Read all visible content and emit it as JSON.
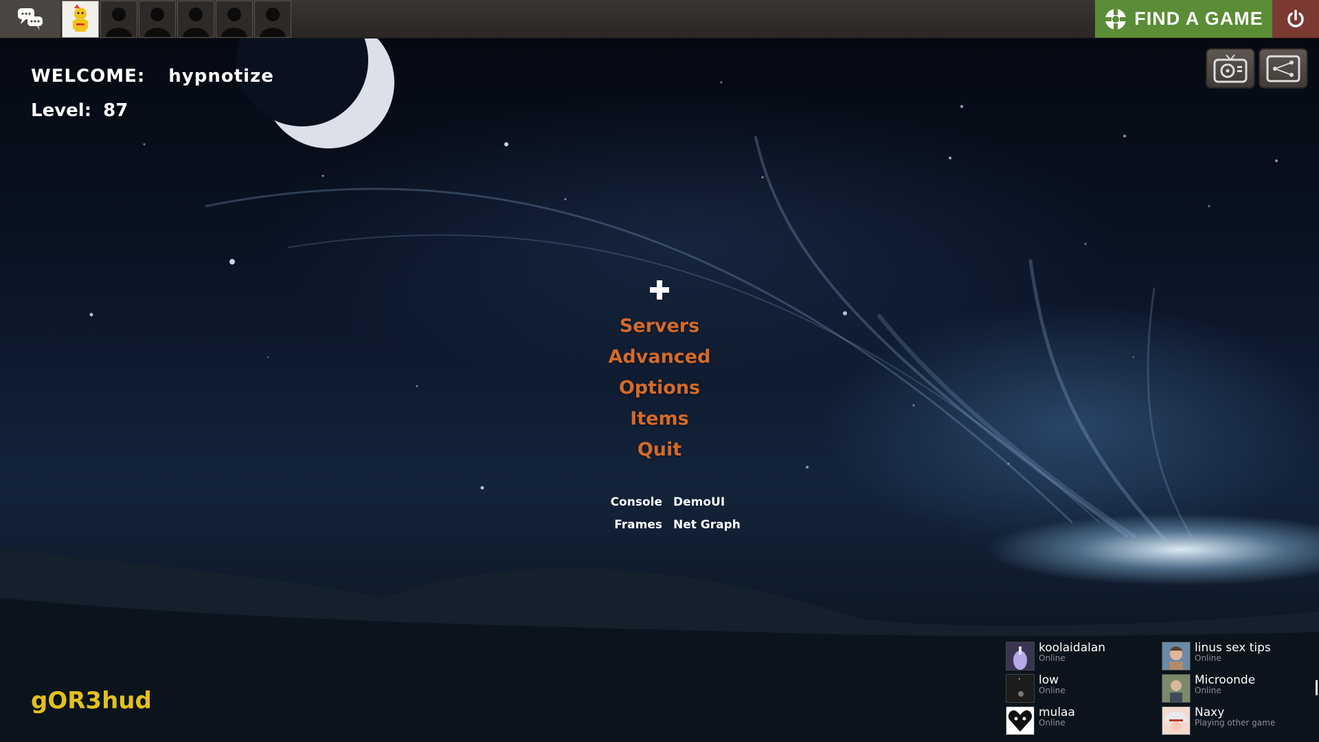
{
  "topbar": {
    "party_slots": [
      "me",
      "empty",
      "empty",
      "empty",
      "empty",
      "empty"
    ],
    "find_game_label": "FIND A GAME"
  },
  "player": {
    "welcome_label": "WELCOME:",
    "username": "hypnotize",
    "level_label": "Level:",
    "level": "87"
  },
  "menu": {
    "items": [
      "Servers",
      "Advanced",
      "Options",
      "Items",
      "Quit"
    ]
  },
  "tools": {
    "console": "Console",
    "demoui": "DemoUI",
    "frames": "Frames",
    "netgraph": "Net Graph"
  },
  "brand": "gOR3hud",
  "friends": [
    {
      "name": "koolaidalan",
      "status": "Online",
      "avatar": "purple-figure"
    },
    {
      "name": "linus sex tips",
      "status": "Online",
      "avatar": "man-portrait"
    },
    {
      "name": "low",
      "status": "Online",
      "avatar": "dark-figure"
    },
    {
      "name": "Microonde",
      "status": "Online",
      "avatar": "man-outdoor"
    },
    {
      "name": "mulaa",
      "status": "Online",
      "avatar": "black-heart"
    },
    {
      "name": "Naxy",
      "status": "Playing other game",
      "avatar": "anime-girl"
    }
  ],
  "colors": {
    "menu_orange": "#d56a2a",
    "brand_yellow": "#e2c01e",
    "find_game_green": "#5b8c36",
    "power_red": "#7a3a32"
  }
}
